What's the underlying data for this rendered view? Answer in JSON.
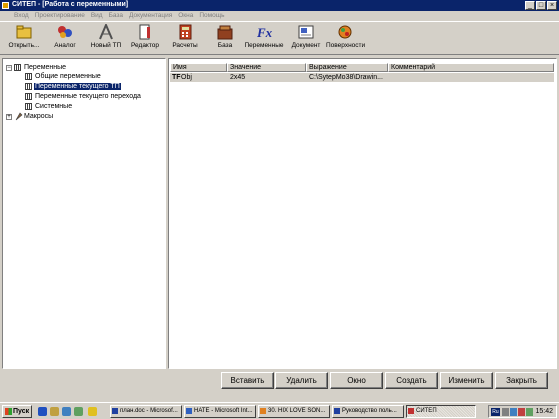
{
  "window": {
    "title": "СИТЕП - [Работа с переменными]",
    "controls": [
      "_",
      "□",
      "×"
    ]
  },
  "menu": [
    "Вход",
    "Проектирование",
    "Вид",
    "База",
    "Документация",
    "Окна",
    "Помощь"
  ],
  "toolbar": [
    {
      "label": "Открыть...",
      "icon": "open-icon"
    },
    {
      "label": "Аналог",
      "icon": "analog-icon"
    },
    {
      "label": "Новый ТП",
      "icon": "new-tp-icon"
    },
    {
      "label": "Редактор",
      "icon": "editor-icon"
    },
    {
      "label": "Расчеты",
      "icon": "calculator-icon"
    },
    {
      "label": "База",
      "icon": "database-icon"
    },
    {
      "label": "Переменные",
      "icon": "fx-icon"
    },
    {
      "label": "Документ",
      "icon": "document-icon"
    },
    {
      "label": "Поверхности",
      "icon": "surfaces-icon"
    }
  ],
  "tree": {
    "root": "Переменные",
    "children": [
      "Общие переменные",
      "Переменные текущего ТП",
      "Переменные текущего перехода",
      "Системные"
    ],
    "selected_index": 1,
    "macros": "Макросы"
  },
  "list": {
    "columns": [
      "Имя",
      "Значение",
      "Выражение",
      "Комментарий"
    ],
    "rows": [
      {
        "name": "Obj",
        "value": "2x45",
        "expression": "C:\\SytepMo38\\Drawin...",
        "comment": ""
      }
    ]
  },
  "buttons": [
    "Вставить",
    "Удалить",
    "Окно",
    "Создать",
    "Изменить",
    "Закрыть"
  ],
  "taskbar": {
    "start": "Пуск",
    "tasks": [
      "план.doc - Microsof...",
      "HATE - Microsoft Int...",
      "30. HIX   LOVE SON...",
      "Руководство поль...",
      "СИТЕП"
    ],
    "lang": "Ru",
    "clock": "15:42"
  },
  "colors": {
    "titlebar": "#0a246a",
    "face": "#d4d0c8",
    "selection": "#0a246a"
  }
}
